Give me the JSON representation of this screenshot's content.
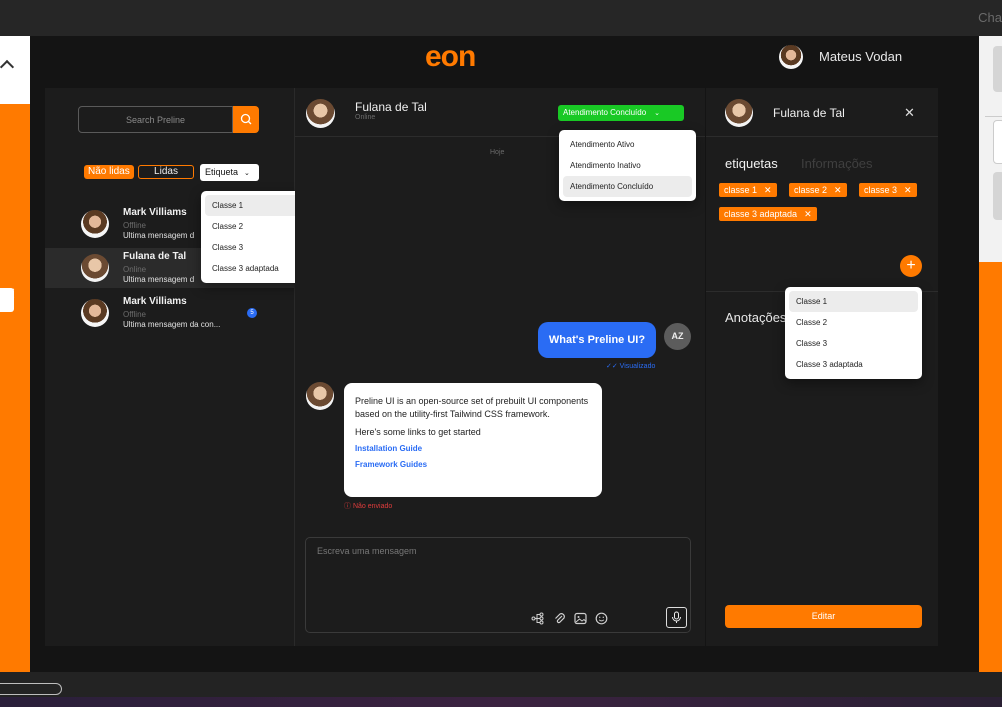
{
  "brand": {
    "logo_text": "eon",
    "accent": "#ff7a00"
  },
  "edge_text": "Cha",
  "user": {
    "name": "Mateus Vodan"
  },
  "contacts": {
    "search_placeholder": "Search Preline",
    "filters": {
      "unread": "Não lidas",
      "read": "Lidas",
      "tag": "Etiqueta"
    },
    "tag_menu": [
      "Classe 1",
      "Classe 2",
      "Classe 3",
      "Classe 3 adaptada"
    ],
    "items": [
      {
        "name": "Mark Villiams",
        "status": "Offline",
        "last": "Ultima mensagem d",
        "badge": ""
      },
      {
        "name": "Fulana de Tal",
        "status": "Online",
        "last": "Ultima mensagem d",
        "badge": ""
      },
      {
        "name": "Mark Villiams",
        "status": "Offline",
        "last": "Ultima mensagem da con...",
        "badge": "5"
      }
    ]
  },
  "chat": {
    "title": "Fulana de Tal",
    "subtitle": "Online",
    "status_button": "Atendimento Concluído",
    "status_menu": [
      "Atendimento Ativo",
      "Atendimento Inativo",
      "Atendimento Concluído"
    ],
    "date_label": "Hoje",
    "outgoing": {
      "text": "What's Preline UI?",
      "avatar_initials": "AZ",
      "receipt": "✓✓ Visualizado"
    },
    "incoming": {
      "line1": "Preline UI is an open-source set of prebuilt UI components based on the utility-first Tailwind CSS framework.",
      "line2": "Here's some links to get started",
      "link1": "Installation Guide",
      "link2": "Framework Guides",
      "error": "ⓘ Não enviado"
    },
    "composer_placeholder": "Escreva uma mensagem"
  },
  "info": {
    "name": "Fulana de Tal",
    "tabs": {
      "tags": "etiquetas",
      "info": "Informações"
    },
    "tags": [
      "classe 1",
      "classe 2",
      "classe 3",
      "classe 3 adaptada"
    ],
    "tag_menu": [
      "Classe 1",
      "Classe 2",
      "Classe 3",
      "Classe 3 adaptada"
    ],
    "notes_label": "Anotações",
    "edit_button": "Editar"
  }
}
